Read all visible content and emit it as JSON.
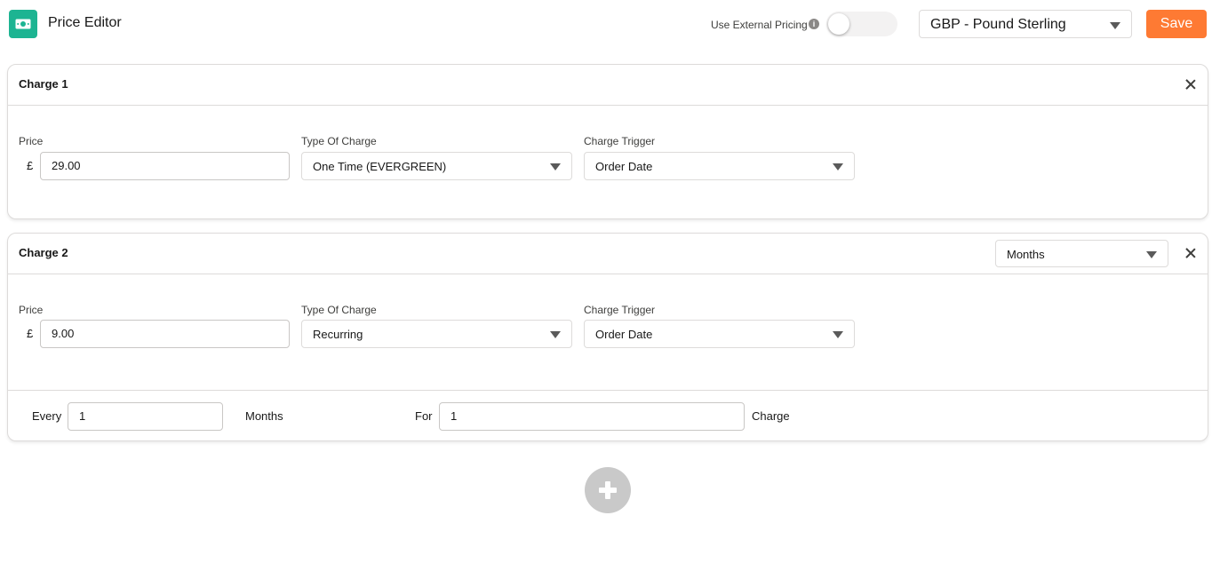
{
  "header": {
    "title": "Price Editor",
    "external_pricing_label": "Use External Pricing",
    "external_pricing_enabled": false,
    "currency": "GBP - Pound Sterling",
    "save_label": "Save"
  },
  "charges": [
    {
      "title": "Charge 1",
      "price_label": "Price",
      "currency_symbol": "£",
      "price": "29.00",
      "type_label": "Type Of Charge",
      "type": "One Time (EVERGREEN)",
      "trigger_label": "Charge Trigger",
      "trigger": "Order Date"
    },
    {
      "title": "Charge 2",
      "period": "Months",
      "price_label": "Price",
      "currency_symbol": "£",
      "price": "9.00",
      "type_label": "Type Of Charge",
      "type": "Recurring",
      "trigger_label": "Charge Trigger",
      "trigger": "Order Date",
      "recurrence": {
        "every_label": "Every",
        "every_value": "1",
        "unit": "Months",
        "for_label": "For",
        "for_value": "1",
        "suffix": "Charge"
      }
    }
  ],
  "colors": {
    "brand": "#1db492",
    "save": "#fe7a33",
    "add_button": "#c9c9c9"
  },
  "icons": {
    "app": "money-icon",
    "info": "info-icon",
    "close": "close-icon",
    "dropdown": "chevron-down-icon",
    "add": "plus-icon"
  }
}
